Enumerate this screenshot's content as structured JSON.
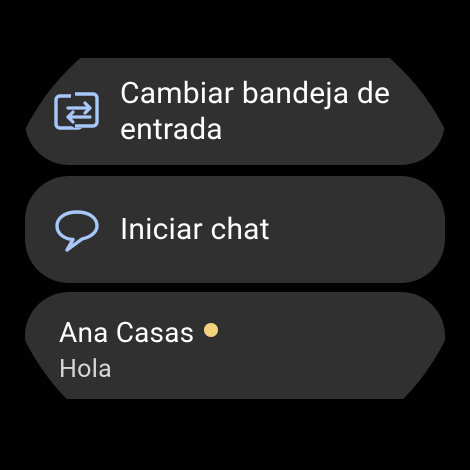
{
  "actions": {
    "switch_inbox": {
      "label": "Cambiar bandeja de entrada",
      "icon": "switch-inbox-icon"
    },
    "start_chat": {
      "label": "Iniciar chat",
      "icon": "chat-bubble-icon"
    }
  },
  "conversation": {
    "name": "Ana Casas",
    "preview": "Hola",
    "status_color": "#f2d27a"
  },
  "colors": {
    "chip_background": "#303030",
    "icon_accent": "#a8c7fa",
    "text": "#ffffff"
  }
}
